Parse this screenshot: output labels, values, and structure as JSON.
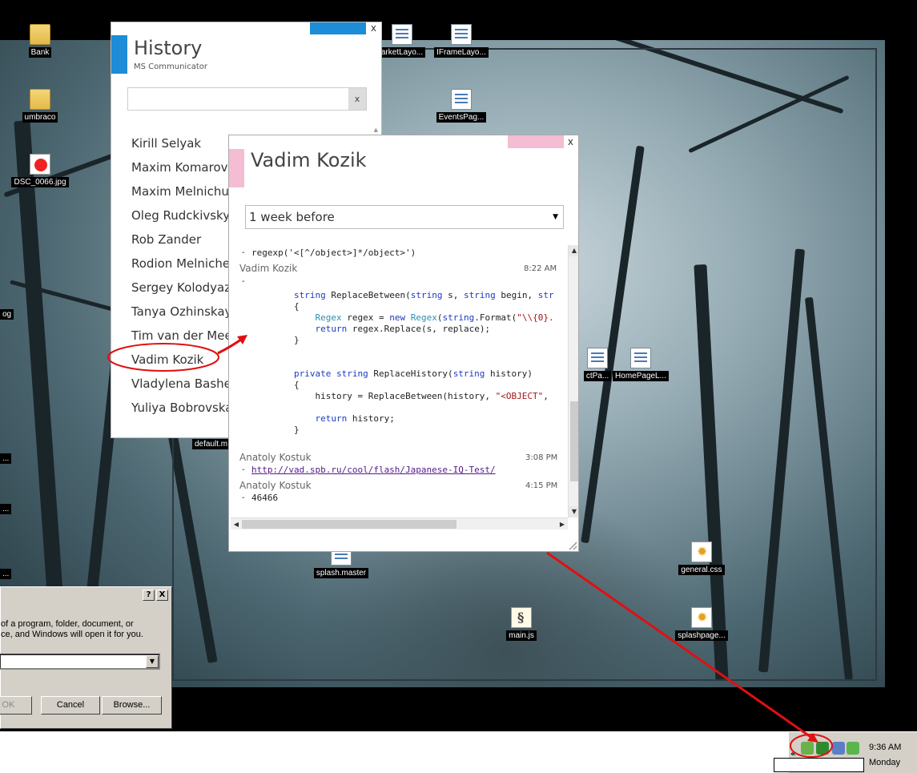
{
  "desktop": {
    "icons": [
      {
        "label": "Bank",
        "kind": "folder"
      },
      {
        "label": "umbraco",
        "kind": "folder"
      },
      {
        "label": "DSC_0066.jpg",
        "kind": "image"
      },
      {
        "label": "arketLayo...",
        "kind": "doc"
      },
      {
        "label": "IFrameLayo...",
        "kind": "doc"
      },
      {
        "label": "EventsPag...",
        "kind": "doc"
      },
      {
        "label": "ctPa...",
        "kind": "doc"
      },
      {
        "label": "HomePageL...",
        "kind": "doc"
      },
      {
        "label": "default.m",
        "kind": "doc"
      },
      {
        "label": "splash.master",
        "kind": "doc"
      },
      {
        "label": "general.css",
        "kind": "gear"
      },
      {
        "label": "main.js",
        "kind": "script"
      },
      {
        "label": "splashpage...",
        "kind": "gear"
      }
    ],
    "partial_labels": [
      "og",
      "..."
    ]
  },
  "history": {
    "title": "History",
    "subtitle": "MS Communicator",
    "search_value": "",
    "clear_label": "x",
    "close_label": "x",
    "contacts": [
      "Kirill Selyak",
      "Maxim Komarov",
      "Maxim Melnichuk",
      "Oleg Rudckivsky",
      "Rob Zander",
      "Rodion Melnichenko",
      "Sergey Kolodyazhny",
      "Tanya Ozhinskaya",
      "Tim van der Meer",
      "Vadim Kozik",
      "Vladylena Bashenko",
      "Yuliya Bobrovskaya"
    ],
    "selected_contact": "Vadim Kozik",
    "accent_color": "#1e8cd6"
  },
  "conversation": {
    "title": "Vadim Kozik",
    "close_label": "x",
    "period": "1 week before",
    "accent_color": "#f4bdd4",
    "messages": {
      "m0_text": "regexp('<[^/object>]*/object>')",
      "m1_sender": "Vadim Kozik",
      "m1_time": "8:22 AM",
      "code_lines": [
        "string ReplaceBetween(string s, string begin, str",
        "{",
        "    Regex regex = new Regex(string.Format(\"\\\\{0}.",
        "    return regex.Replace(s, replace);",
        "}",
        "",
        "",
        "private string ReplaceHistory(string history)",
        "{",
        "    history = ReplaceBetween(history, \"<OBJECT\",",
        "",
        "    return history;",
        "}"
      ],
      "m2_sender": "Anatoly Kostuk",
      "m2_time": "3:08 PM",
      "m2_link": "http://vad.spb.ru/cool/flash/Japanese-IQ-Test/",
      "m3_sender": "Anatoly Kostuk",
      "m3_time": "4:15 PM",
      "m3_text": "46466"
    }
  },
  "run_dialog": {
    "help_label": "?",
    "close_label": "X",
    "description": "of a program, folder, document, or\nce, and Windows will open it for you.",
    "ok_label": "OK",
    "cancel_label": "Cancel",
    "browse_label": "Browse..."
  },
  "tray": {
    "time": "9:36 AM",
    "day": "Monday",
    "chevron": "«"
  },
  "annotation_color": "#e01010"
}
